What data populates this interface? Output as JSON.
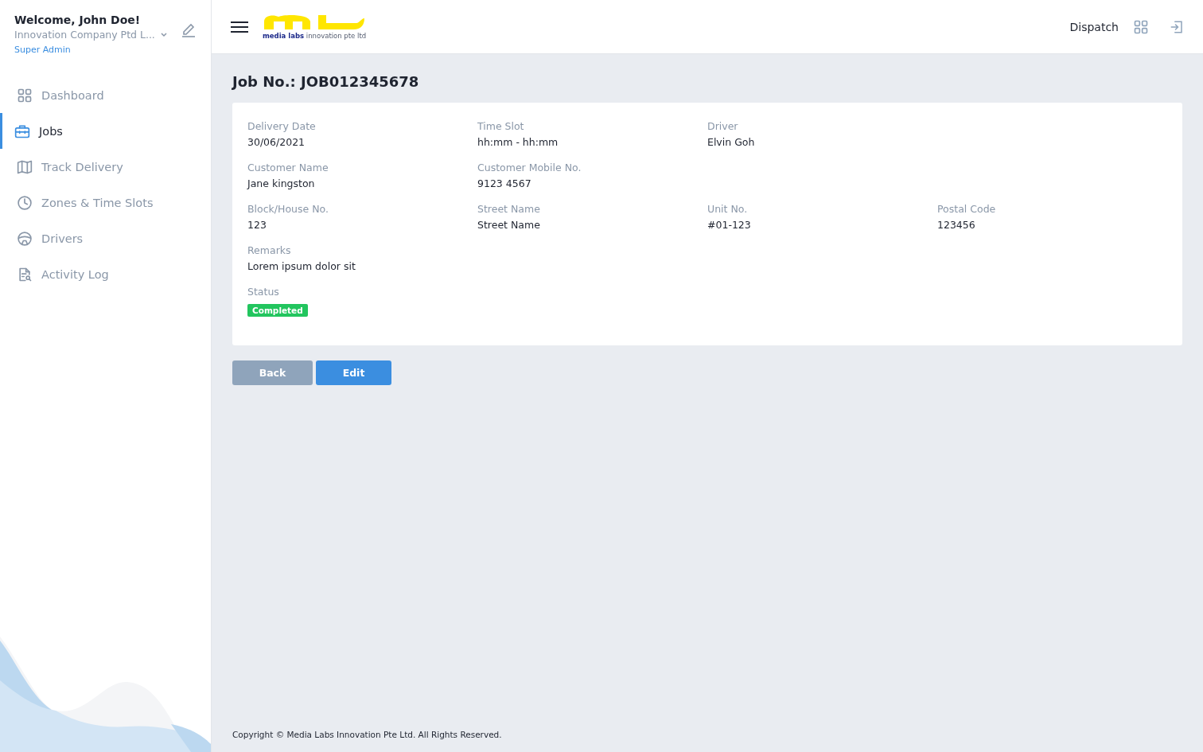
{
  "user": {
    "welcome": "Welcome, John Doe!",
    "company": "Innovation Company Ptd L...",
    "role": "Super Admin"
  },
  "sidebar": {
    "items": [
      {
        "label": "Dashboard",
        "selected": false
      },
      {
        "label": "Jobs",
        "selected": true
      },
      {
        "label": "Track Delivery",
        "selected": false
      },
      {
        "label": "Zones & Time Slots",
        "selected": false
      },
      {
        "label": "Drivers",
        "selected": false
      },
      {
        "label": "Activity Log",
        "selected": false
      }
    ]
  },
  "header": {
    "logo_text": "**media labs** innovation pte ltd",
    "module": "Dispatch"
  },
  "job": {
    "title": "Job No.: JOB012345678",
    "rows": [
      [
        {
          "label": "Delivery Date",
          "value": "30/06/2021"
        },
        {
          "label": "Time Slot",
          "value": "hh:mm - hh:mm"
        },
        {
          "label": "Driver",
          "value": "Elvin Goh"
        }
      ],
      [
        {
          "label": "Customer Name",
          "value": "Jane kingston"
        },
        {
          "label": "Customer Mobile No.",
          "value": "9123 4567"
        }
      ],
      [
        {
          "label": "Block/House No.",
          "value": "123"
        },
        {
          "label": "Street Name",
          "value": "Street Name"
        },
        {
          "label": "Unit No.",
          "value": "#01-123"
        },
        {
          "label": "Postal Code",
          "value": "123456"
        }
      ],
      [
        {
          "label": "Remarks",
          "value": "Lorem ipsum dolor sit"
        }
      ]
    ],
    "status": {
      "label": "Status",
      "value": "Completed",
      "color": "#22c55e"
    }
  },
  "buttons": [
    {
      "label": "Back",
      "kind": "secondary"
    },
    {
      "label": "Edit",
      "kind": "primary"
    }
  ],
  "footer": "Copyright © Media Labs Innovation Pte Ltd. All Rights Reserved."
}
